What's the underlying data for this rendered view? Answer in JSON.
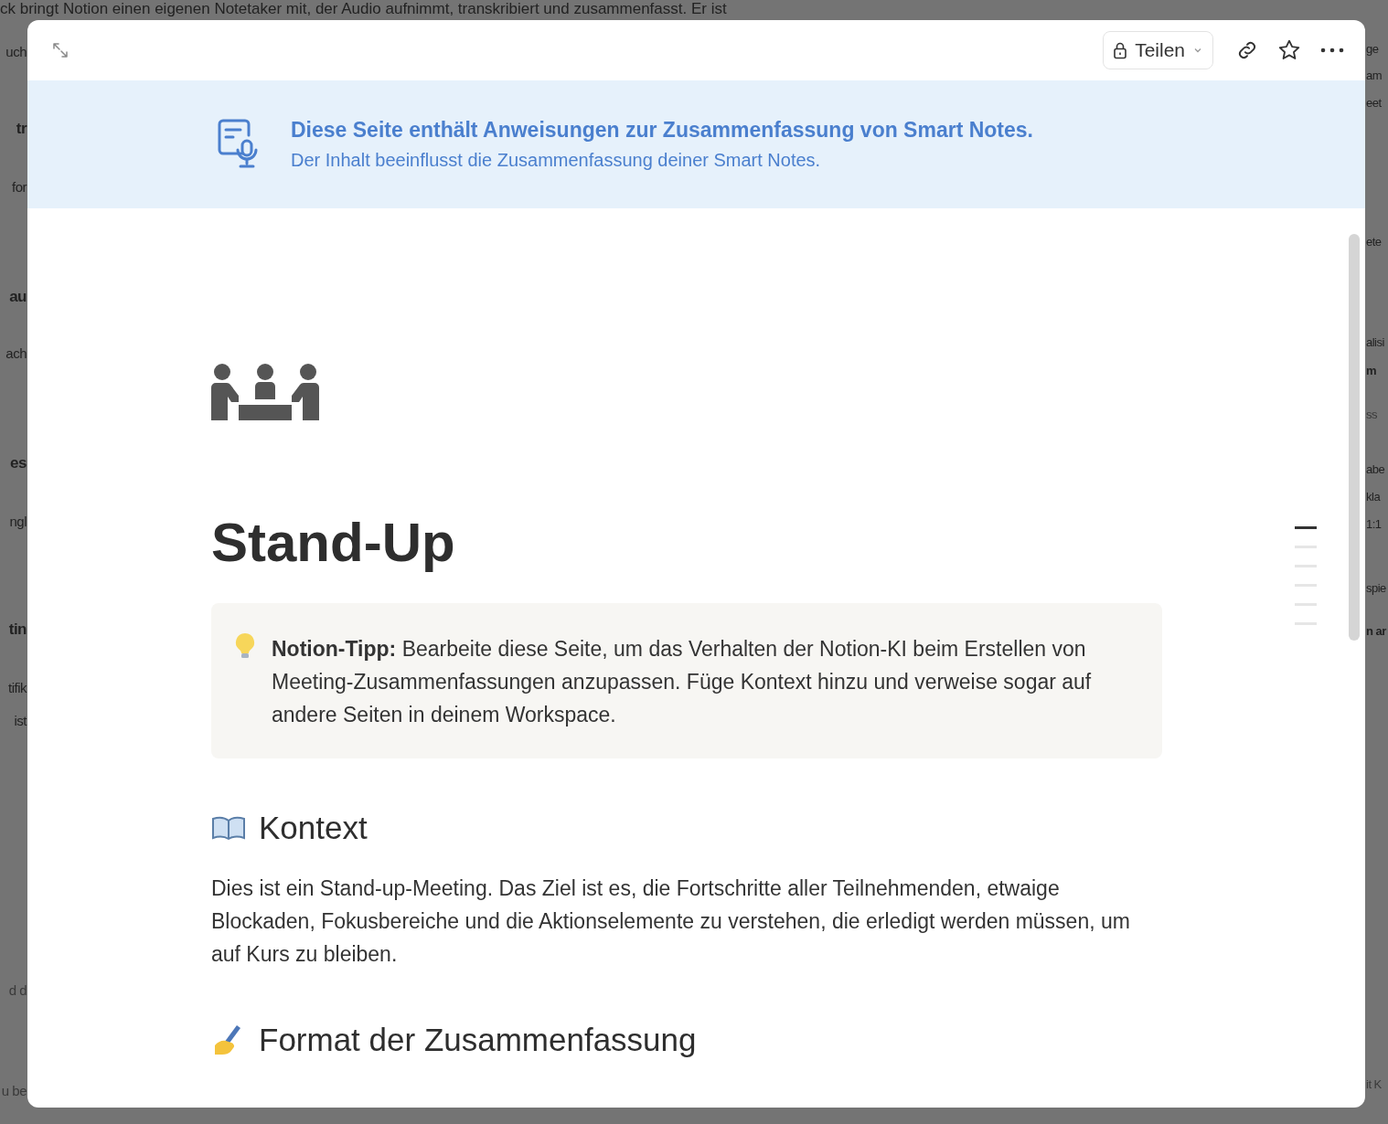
{
  "background": {
    "top_line": "ck bringt Notion einen eigenen Notetaker mit, der Audio aufnimmt, transkribiert und zusammenfasst. Er ist",
    "left_fragments": [
      {
        "text": "uch",
        "kind": "text"
      },
      {
        "text": "tr",
        "kind": "bold"
      },
      {
        "text": "for",
        "kind": "text"
      },
      {
        "text": "au",
        "kind": "bold"
      },
      {
        "text": "ach",
        "kind": "text"
      },
      {
        "text": "es",
        "kind": "bold"
      },
      {
        "text": "ngl",
        "kind": "text"
      },
      {
        "text": "tin",
        "kind": "bold"
      },
      {
        "text": "tifik",
        "kind": "text"
      },
      {
        "text": "ist",
        "kind": "text"
      },
      {
        "text": "d d",
        "kind": "muted"
      },
      {
        "text": "u be",
        "kind": "muted"
      }
    ],
    "right_fragments": [
      {
        "text": "ge",
        "kind": "text"
      },
      {
        "text": "am",
        "kind": "text"
      },
      {
        "text": "eet",
        "kind": "text"
      },
      {
        "text": "ete",
        "kind": "text"
      },
      {
        "text": "alisi",
        "kind": "text"
      },
      {
        "text": "m",
        "kind": "bold"
      },
      {
        "text": "ss",
        "kind": "muted"
      },
      {
        "text": "abe",
        "kind": "text"
      },
      {
        "text": "kla",
        "kind": "text"
      },
      {
        "text": "1:1",
        "kind": "text"
      },
      {
        "text": "spie",
        "kind": "text"
      },
      {
        "text": "n ar",
        "kind": "bold"
      },
      {
        "text": "it K",
        "kind": "muted"
      }
    ]
  },
  "header": {
    "share_button": "Teilen"
  },
  "banner": {
    "title": "Diese Seite enthält Anweisungen zur Zusammenfassung von Smart Notes.",
    "subtitle": "Der Inhalt beeinflusst die Zusammenfassung deiner Smart Notes."
  },
  "page": {
    "title": "Stand-Up",
    "callout": "**Notion-Tipp:** Bearbeite diese Seite, um das Verhalten der Notion-KI beim Erstellen von Meeting-Zusammenfassungen anzupassen. Füge Kontext hinzu und verweise sogar auf andere Seiten in deinem Workspace.",
    "sections": [
      {
        "kind": "book",
        "heading": "Kontext",
        "paragraph": "Dies ist ein Stand-up-Meeting. Das Ziel ist es, die Fortschritte aller Teilnehmenden, etwaige Blockaden, Fokusbereiche und die Aktionselemente zu verstehen, die erledigt werden müssen, um auf Kurs zu bleiben."
      },
      {
        "kind": "writing",
        "heading": "Format der Zusammenfassung"
      }
    ]
  },
  "toc": [
    {
      "selected": true
    },
    {
      "selected": false
    },
    {
      "selected": false
    },
    {
      "selected": false
    },
    {
      "selected": false
    },
    {
      "selected": false
    }
  ]
}
